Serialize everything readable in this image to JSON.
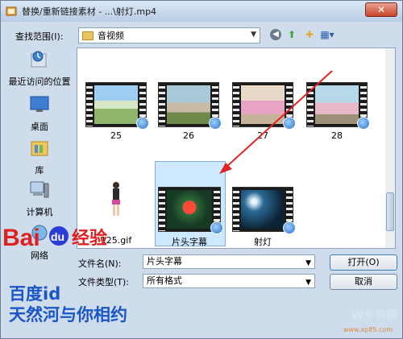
{
  "window": {
    "title": "替换/重新链接素材 - ...\\射灯.mp4",
    "close_glyph": "✕"
  },
  "toolbar": {
    "lookin_label": "查找范围(I):",
    "lookin_value": "音视频",
    "dropdown_glyph": "▼",
    "back_glyph": "◀",
    "up_glyph": "⬆",
    "new_folder_glyph": "✚",
    "views_glyph": "▦▾"
  },
  "places": [
    {
      "label": "最近访问的位置",
      "icon": "recent-places-icon"
    },
    {
      "label": "桌面",
      "icon": "desktop-icon"
    },
    {
      "label": "库",
      "icon": "library-icon"
    },
    {
      "label": "计算机",
      "icon": "computer-icon"
    },
    {
      "label": "网络",
      "icon": "network-icon"
    }
  ],
  "files": [
    {
      "label": "25",
      "kind": "video"
    },
    {
      "label": "26",
      "kind": "video"
    },
    {
      "label": "27",
      "kind": "video"
    },
    {
      "label": "28",
      "kind": "video"
    },
    {
      "label": "125.gif",
      "kind": "image"
    },
    {
      "label": "片头字幕",
      "kind": "video",
      "selected": true
    },
    {
      "label": "射灯",
      "kind": "video"
    }
  ],
  "form": {
    "filename_label": "文件名(N):",
    "filename_value": "片头字幕",
    "filetype_label": "文件类型(T):",
    "filetype_value": "所有格式",
    "open_button": "打开(O)",
    "cancel_button": "取消"
  },
  "watermark": {
    "baidu_logo": "Bai du经验",
    "line1": "百度id",
    "line2": "天然河与你相约",
    "brand": "W乡包德",
    "url": "www.xp85.com"
  },
  "colors": {
    "annotation_arrow": "#e02424",
    "selection": "#cde8ff",
    "baidu_red": "#e02020",
    "baidu_blue": "#2b3bd6"
  }
}
